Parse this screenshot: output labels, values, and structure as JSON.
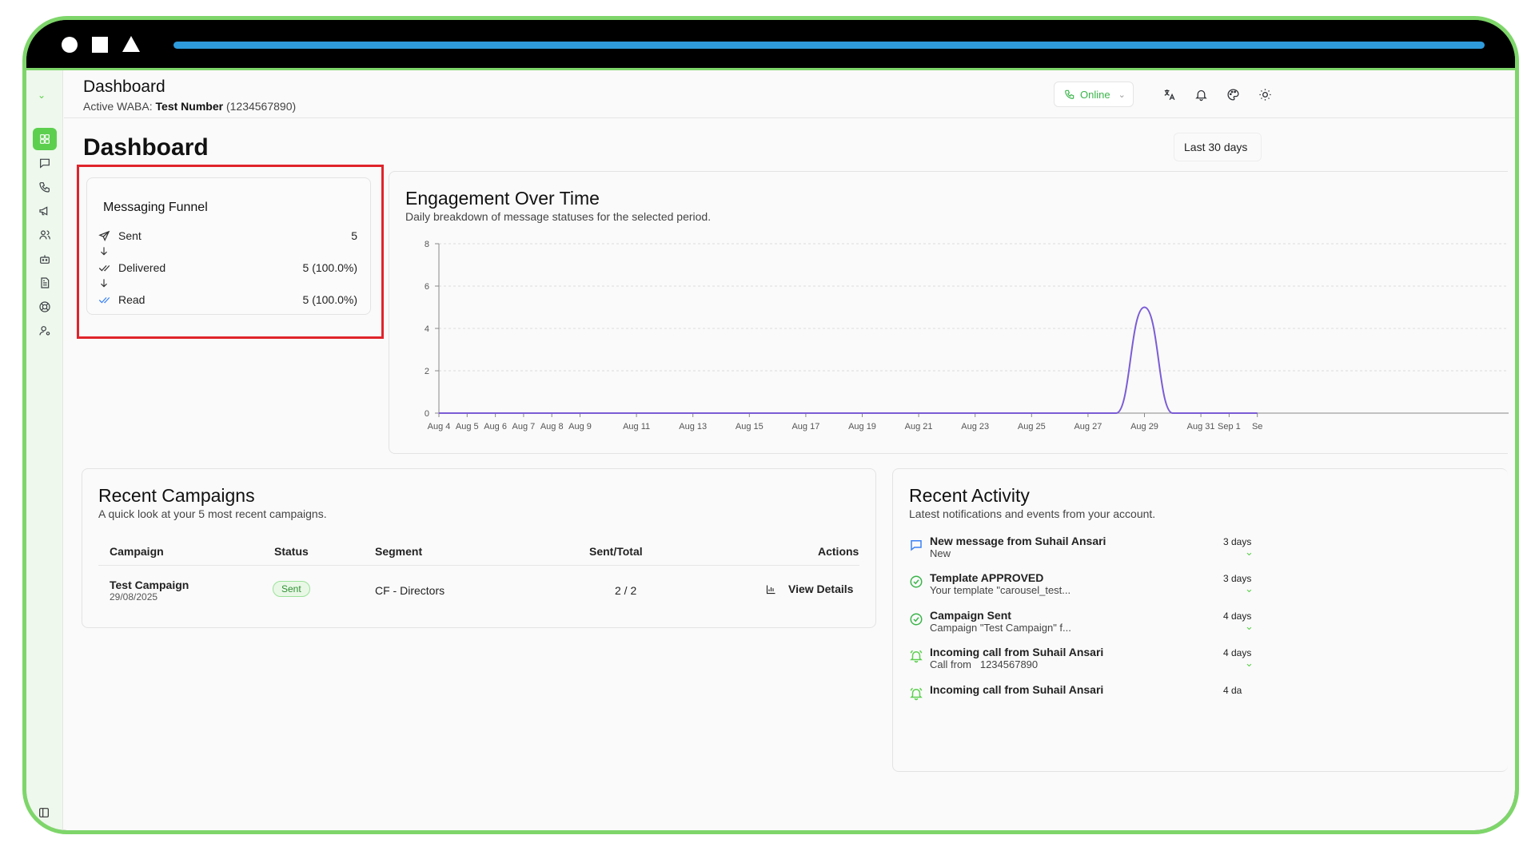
{
  "header": {
    "title": "Dashboard",
    "active_waba_label": "Active WABA:",
    "active_waba_name": "Test Number",
    "active_waba_number": "(1234567890)",
    "status_label": "Online"
  },
  "page": {
    "title": "Dashboard",
    "date_range": "Last 30 days"
  },
  "funnel": {
    "title": "Messaging Funnel",
    "rows": [
      {
        "label": "Sent",
        "value": "5"
      },
      {
        "label": "Delivered",
        "value": "5 (100.0%)"
      },
      {
        "label": "Read",
        "value": "5 (100.0%)"
      }
    ]
  },
  "engagement": {
    "title": "Engagement Over Time",
    "subtitle": "Daily breakdown of message statuses for the selected period."
  },
  "chart_data": {
    "type": "line",
    "title": "Engagement Over Time",
    "ylim": [
      0,
      8
    ],
    "yticks": [
      0,
      2,
      4,
      6,
      8
    ],
    "x_labels": [
      "Aug 4",
      "Aug 5",
      "Aug 6",
      "Aug 7",
      "Aug 8",
      "Aug 9",
      "Aug 11",
      "Aug 13",
      "Aug 15",
      "Aug 17",
      "Aug 19",
      "Aug 21",
      "Aug 23",
      "Aug 25",
      "Aug 27",
      "Aug 29",
      "Aug 31",
      "Sep 1",
      "Se"
    ],
    "series": [
      {
        "color": "#7b5cd6",
        "points": [
          {
            "x": "Aug 4",
            "y": 0
          },
          {
            "x": "Aug 27",
            "y": 0
          },
          {
            "x": "Aug 28",
            "y": 0
          },
          {
            "x": "Aug 29",
            "y": 5
          },
          {
            "x": "Aug 30",
            "y": 0
          },
          {
            "x": "Sep 2",
            "y": 0
          }
        ]
      }
    ],
    "grid": true
  },
  "campaigns": {
    "title": "Recent Campaigns",
    "subtitle": "A quick look at your 5 most recent campaigns.",
    "columns": [
      "Campaign",
      "Status",
      "Segment",
      "Sent/Total",
      "Actions"
    ],
    "rows": [
      {
        "name": "Test Campaign",
        "date": "29/08/2025",
        "status": "Sent",
        "segment": "CF - Directors",
        "sent_total": "2 / 2",
        "action": "View Details"
      }
    ]
  },
  "activity": {
    "title": "Recent Activity",
    "subtitle": "Latest notifications and events from your account.",
    "items": [
      {
        "icon": "message-icon",
        "title": "New message from Suhail Ansari",
        "desc": "New",
        "time": "3 days",
        "color": "#3b82f6"
      },
      {
        "icon": "check-circle-icon",
        "title": "Template APPROVED",
        "desc": "Your template \"carousel_test...",
        "time": "3 days",
        "color": "#3bb54a"
      },
      {
        "icon": "check-circle-icon",
        "title": "Campaign Sent",
        "desc": "Campaign \"Test Campaign\" f...",
        "time": "4 days",
        "color": "#3bb54a"
      },
      {
        "icon": "bell-ring-icon",
        "title": "Incoming call from Suhail Ansari",
        "desc": "Call from   1234567890",
        "time": "4 days",
        "color": "#5ccf4e"
      },
      {
        "icon": "bell-ring-icon",
        "title": "Incoming call from Suhail Ansari",
        "desc": "",
        "time": "4 da",
        "color": "#5ccf4e"
      }
    ]
  }
}
